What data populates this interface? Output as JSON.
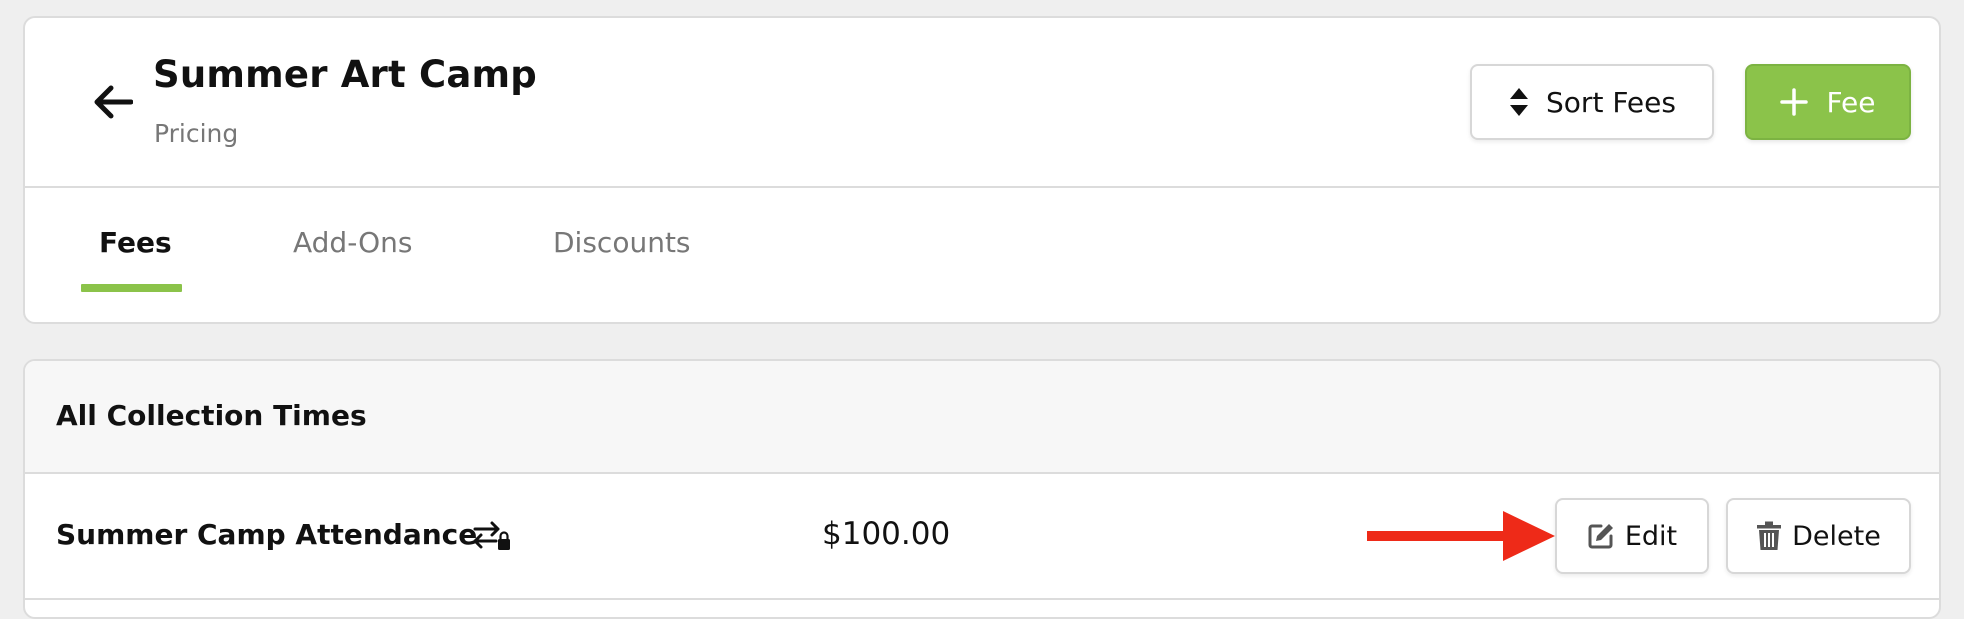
{
  "header": {
    "title": "Summer Art Camp",
    "subtitle": "Pricing",
    "back_icon": "arrow-left-icon",
    "sort_button": {
      "label": "Sort Fees",
      "icon": "sort-icon"
    },
    "add_fee_button": {
      "label": "Fee",
      "icon": "plus-icon",
      "color": "#8bc34a"
    }
  },
  "tabs": [
    {
      "label": "Fees",
      "active": true
    },
    {
      "label": "Add-Ons",
      "active": false
    },
    {
      "label": "Discounts",
      "active": false
    }
  ],
  "fees_section": {
    "title": "All Collection Times",
    "rows": [
      {
        "name": "Summer Camp Attendance",
        "icon": "locked-transfer-icon",
        "price": "$100.00",
        "edit_label": "Edit",
        "edit_icon": "edit-icon",
        "delete_label": "Delete",
        "delete_icon": "trash-icon"
      }
    ]
  },
  "annotation": {
    "icon": "red-arrow-pointer",
    "color": "#ee2a18"
  }
}
